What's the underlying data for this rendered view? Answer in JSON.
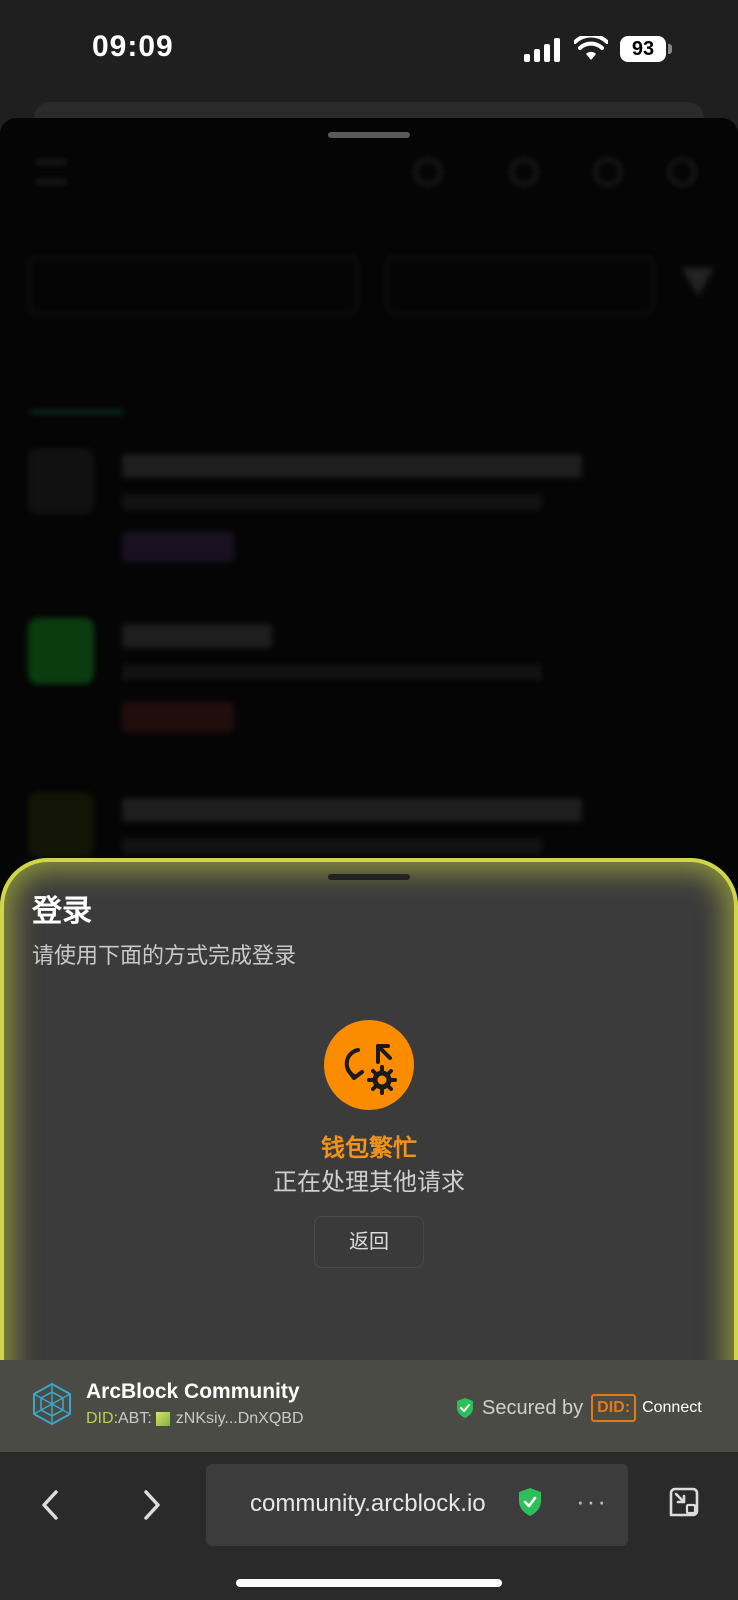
{
  "status_bar": {
    "time": "09:09",
    "battery": "93"
  },
  "modal": {
    "title": "登录",
    "subtitle": "请使用下面的方式完成登录",
    "status_title": "钱包繁忙",
    "status_desc": "正在处理其他请求",
    "back_label": "返回"
  },
  "footer": {
    "app_name": "ArcBlock Community",
    "did_prefix": "DID",
    "did_rest": ":ABT:",
    "did_value": "zNKsiy...DnXQBD",
    "secured_by": "Secured by",
    "did_badge": "DID:",
    "connect": "Connect"
  },
  "browser": {
    "url": "community.arcblock.io",
    "more": "···"
  },
  "colors": {
    "accent_orange": "#fb8c00",
    "status_title": "#f29217",
    "modal_border": "#cfd64a",
    "secure_green": "#2fbf5a"
  },
  "icons": [
    "wallet-busy-icon",
    "back-arrow-icon",
    "forward-arrow-icon",
    "secure-shield-icon",
    "exit-fullscreen-icon",
    "arcblock-logo-icon"
  ]
}
